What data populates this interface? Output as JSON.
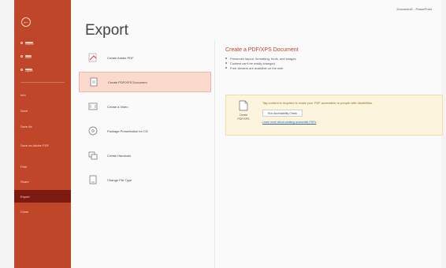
{
  "window": {
    "title": "Document1 - PowerPoint"
  },
  "nav": {
    "back_glyph": "←",
    "items": [
      {
        "label": "Home",
        "icon": "home-icon"
      },
      {
        "label": "New",
        "icon": "new-icon"
      },
      {
        "label": "Open",
        "icon": "open-icon"
      },
      {
        "label": "Info",
        "icon": "info-icon"
      },
      {
        "label": "Save",
        "icon": "save-icon"
      },
      {
        "label": "Save As",
        "icon": "save-as-icon"
      },
      {
        "label": "Save as Adobe PDF",
        "icon": "pdf-icon"
      },
      {
        "label": "Print",
        "icon": "print-icon"
      },
      {
        "label": "Share",
        "icon": "share-icon"
      },
      {
        "label": "Export",
        "icon": "export-icon",
        "active": true
      },
      {
        "label": "Close",
        "icon": "close-icon"
      }
    ]
  },
  "page": {
    "title": "Export"
  },
  "export_options": [
    {
      "label": "Create Adobe PDF",
      "icon": "adobe-pdf-icon"
    },
    {
      "label": "Create PDF/XPS Document",
      "icon": "pdf-xps-icon",
      "selected": true
    },
    {
      "label": "Create a Video",
      "icon": "video-icon"
    },
    {
      "label": "Package Presentation for CD",
      "icon": "cd-icon"
    },
    {
      "label": "Create Handouts",
      "icon": "handouts-icon"
    },
    {
      "label": "Change File Type",
      "icon": "file-type-icon"
    }
  ],
  "detail": {
    "heading": "Create a PDF/XPS Document",
    "bullets": [
      "Preserves layout, formatting, fonts, and images",
      "Content can't be easily changed",
      "Free viewers are available on the web"
    ]
  },
  "callout": {
    "button_label_1": "Create",
    "button_label_2": "PDF/XPS",
    "message": "Tag content is required to make your PDF accessible to people with disabilities.",
    "check_label": "Run Accessibility Check",
    "link_label": "Learn more about creating accessible PDFs"
  },
  "colors": {
    "nav_bg": "#c0462a",
    "nav_active": "#7a1a10",
    "accent": "#c0462a",
    "selected_bg": "#fbd9cd",
    "callout_bg": "#fdf4dd"
  }
}
